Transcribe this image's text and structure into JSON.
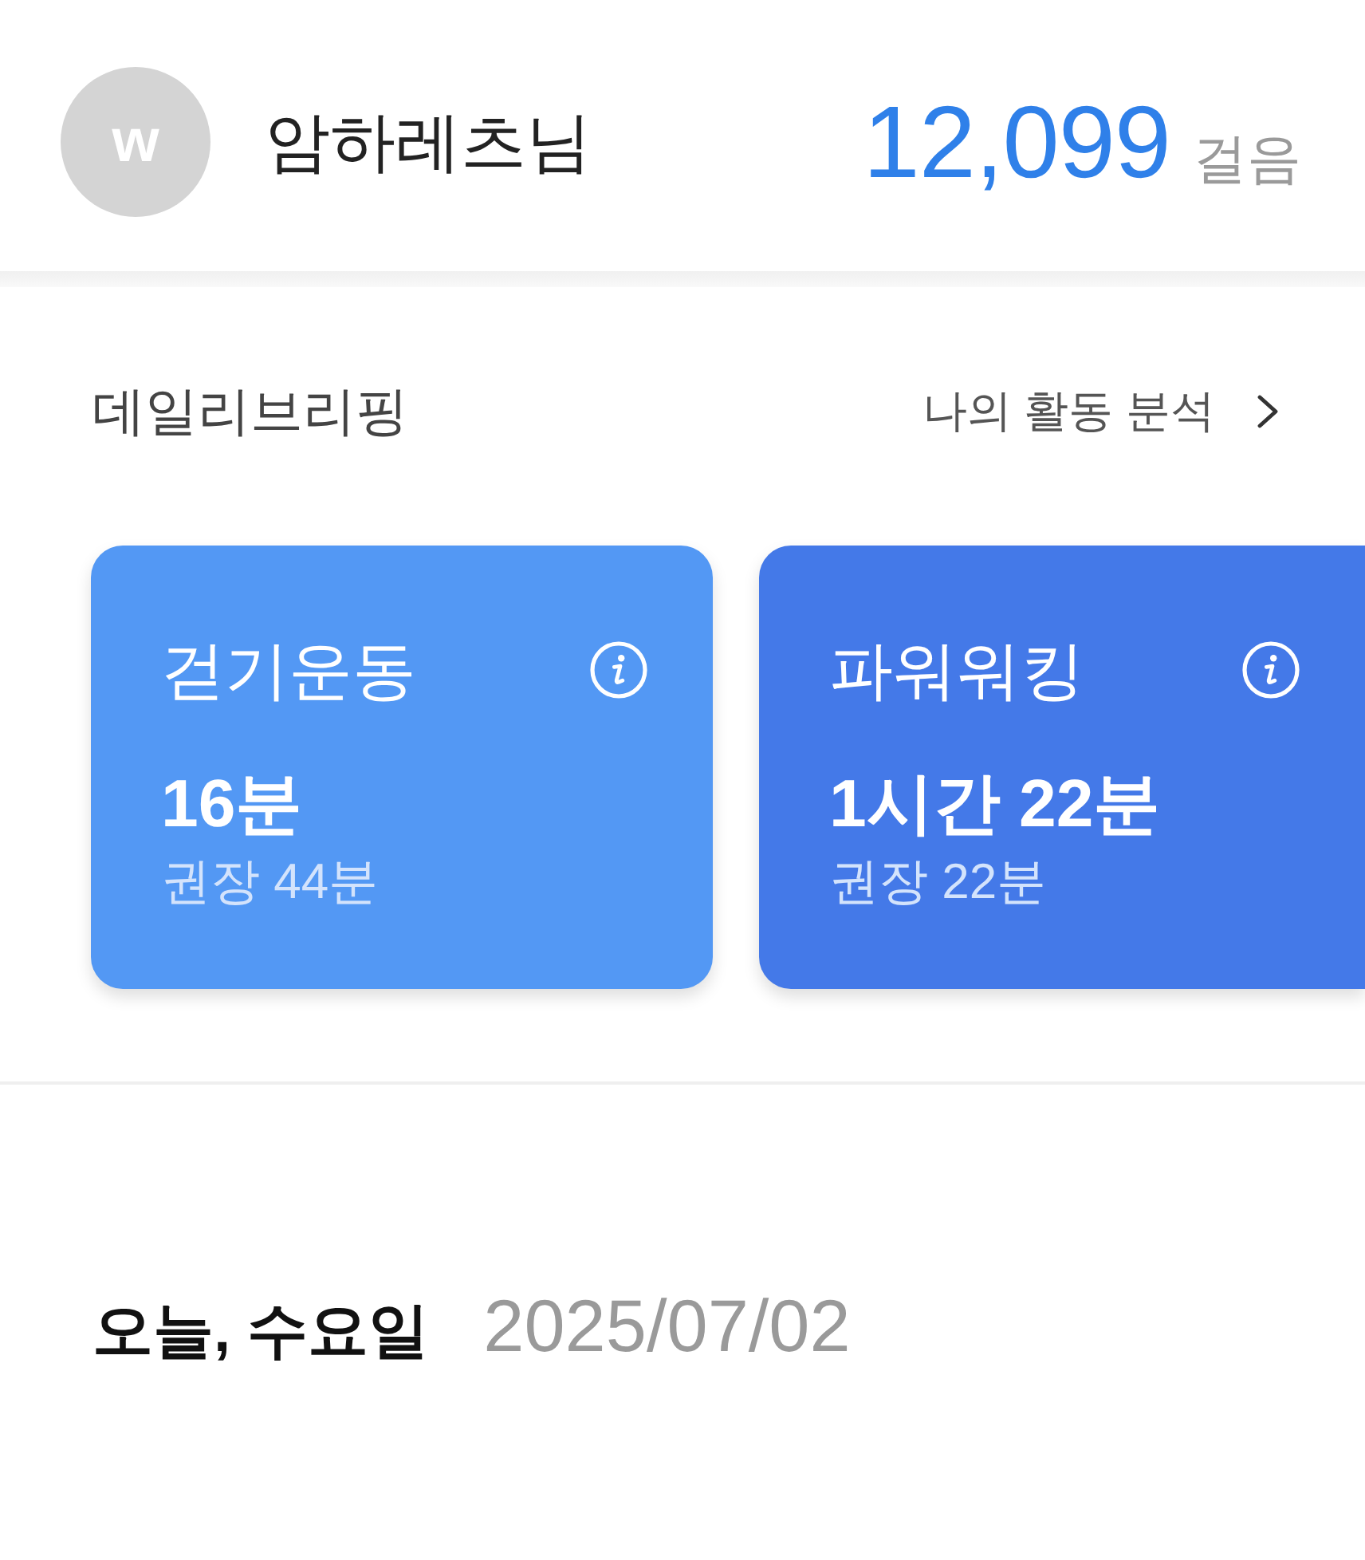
{
  "header": {
    "avatar": {
      "letter": "w"
    },
    "user_name": "암하레츠님",
    "steps": {
      "count": "12,099",
      "unit": "걸음"
    }
  },
  "daily_briefing": {
    "title": "데일리브리핑",
    "link": "나의 활동 분석",
    "cards": [
      {
        "title": "걷기운동",
        "value": "16분",
        "recommended": "권장 44분",
        "color": "#5398f4"
      },
      {
        "title": "파워워킹",
        "value": "1시간 22분",
        "recommended": "권장 22분",
        "color": "#4479e8"
      }
    ]
  },
  "today": {
    "label": "오늘, 수요일",
    "date": "2025/07/02"
  }
}
